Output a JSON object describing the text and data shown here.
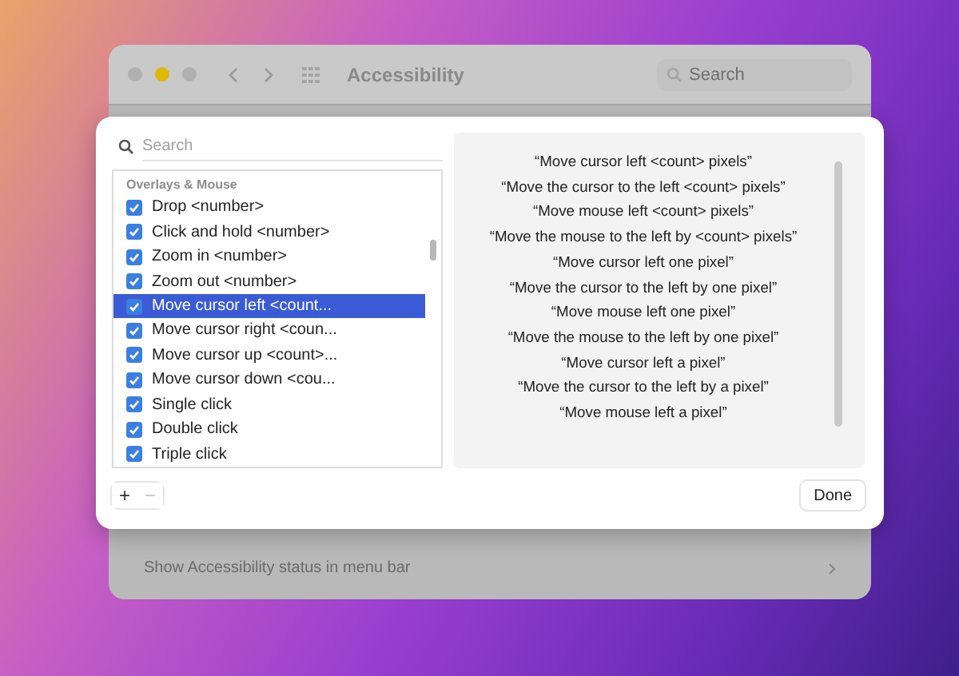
{
  "background_window": {
    "title": "Accessibility",
    "search_placeholder": "Search",
    "row_label": "Show Accessibility status in menu bar"
  },
  "sheet": {
    "search": {
      "placeholder": "Search"
    },
    "list": {
      "section": "Overlays & Mouse",
      "items": [
        {
          "label": "Drop <number>",
          "checked": true,
          "selected": false
        },
        {
          "label": "Click and hold <number>",
          "checked": true,
          "selected": false
        },
        {
          "label": "Zoom in <number>",
          "checked": true,
          "selected": false
        },
        {
          "label": "Zoom out <number>",
          "checked": true,
          "selected": false
        },
        {
          "label": "Move cursor left <count...",
          "checked": true,
          "selected": true
        },
        {
          "label": "Move cursor right <coun...",
          "checked": true,
          "selected": false
        },
        {
          "label": "Move cursor up <count>...",
          "checked": true,
          "selected": false
        },
        {
          "label": "Move cursor down <cou...",
          "checked": true,
          "selected": false
        },
        {
          "label": "Single click",
          "checked": true,
          "selected": false
        },
        {
          "label": "Double click",
          "checked": true,
          "selected": false
        },
        {
          "label": "Triple click",
          "checked": true,
          "selected": false
        }
      ]
    },
    "phrases": [
      "“Move cursor left <count> pixels”",
      "“Move the cursor to the left <count> pixels”",
      "“Move mouse left <count> pixels”",
      "“Move the mouse to the left by <count> pixels”",
      "“Move cursor left one pixel”",
      "“Move the cursor to the left by one pixel”",
      "“Move mouse left one pixel”",
      "“Move the mouse to the left by one pixel”",
      "“Move cursor left a pixel”",
      "“Move the cursor to the left by a pixel”",
      "“Move mouse left a pixel”"
    ],
    "add_button": {
      "label": "+",
      "disabled": false
    },
    "remove_button": {
      "label": "−",
      "disabled": true
    },
    "done_button": {
      "label": "Done"
    }
  }
}
